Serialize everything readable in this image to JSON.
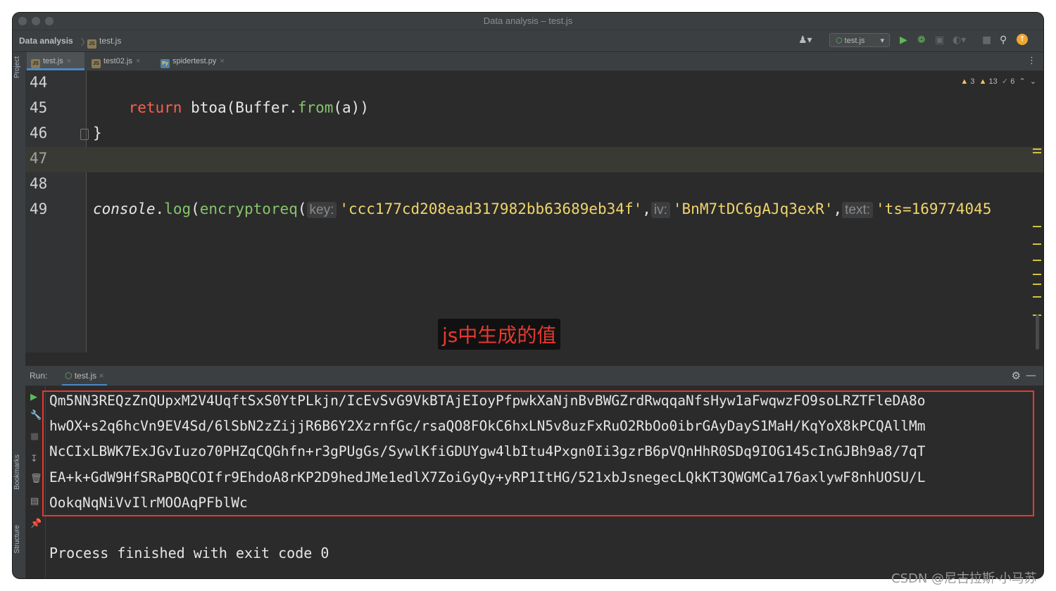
{
  "window": {
    "title": "Data analysis – test.js"
  },
  "navbar": {
    "project": "Data analysis",
    "file": "test.js",
    "run_config": "test.js"
  },
  "sidebar": {
    "project": "Project",
    "bookmarks": "Bookmarks",
    "structure": "Structure"
  },
  "tabs": [
    {
      "label": "test.js",
      "icon": "js-file-icon"
    },
    {
      "label": "test02.js",
      "icon": "js-file-icon"
    },
    {
      "label": "spidertest.py",
      "icon": "python-file-icon"
    }
  ],
  "inspections": {
    "warnings_a": "3",
    "warnings_b": "13",
    "ok": "6"
  },
  "editor": {
    "line_numbers": [
      "44",
      "45",
      "46",
      "47",
      "48",
      "49"
    ],
    "line45": {
      "indent": "    ",
      "kw": "return",
      "sp": " ",
      "call": "btoa(Buffer.",
      "fn": "from",
      "rest": "(a))"
    },
    "line46": "}",
    "line49": {
      "obj": "console",
      "dot": ".",
      "method": "log",
      "open1": "(",
      "func": "encryptoreq",
      "open2": "(",
      "hint_key": "key:",
      "key": "'ccc177cd208ead317982bb63689eb34f'",
      "comma": ",",
      "hint_iv": "iv:",
      "iv": "'BnM7tDC6gAJq3exR'",
      "hint_text": "text:",
      "text": "'ts=169774045"
    }
  },
  "annotation": "js中生成的值",
  "run": {
    "label": "Run:",
    "tab": "test.js",
    "output_lines": [
      "Qm5NN3REQzZnQUpxM2V4UqftSxS0YtPLkjn/IcEvSvG9VkBTAjEIoyPfpwkXaNjnBvBWGZrdRwqqaNfsHyw1aFwqwzFO9soLRZTFleDA8o",
      "hwOX+s2q6hcVn9EV4Sd/6lSbN2zZijjR6B6Y2XzrnfGc/rsaQO8FOkC6hxLN5v8uzFxRuO2RbOo0ibrGAyDayS1MaH/KqYoX8kPCQAllMm",
      "NcCIxLBWK7ExJGvIuzo70PHZqCQGhfn+r3gPUgGs/SywlKfiGDUYgw4lbItu4Pxgn0Ii3gzrB6pVQnHhR0SDq9IOG145cInGJBh9a8/7qT",
      "EA+k+GdW9HfSRaPBQCOIfr9EhdoA8rKP2D9hedJMe1edlX7ZoiGyQy+yRP1ItHG/521xbJsnegecLQkKT3QWGMCa176axlywF8nhUOSU/L",
      "OokqNqNiVvIlrMOOAqPFblWc"
    ],
    "exit": "Process finished with exit code 0"
  },
  "watermark": "CSDN @尼古拉斯·小马苏"
}
